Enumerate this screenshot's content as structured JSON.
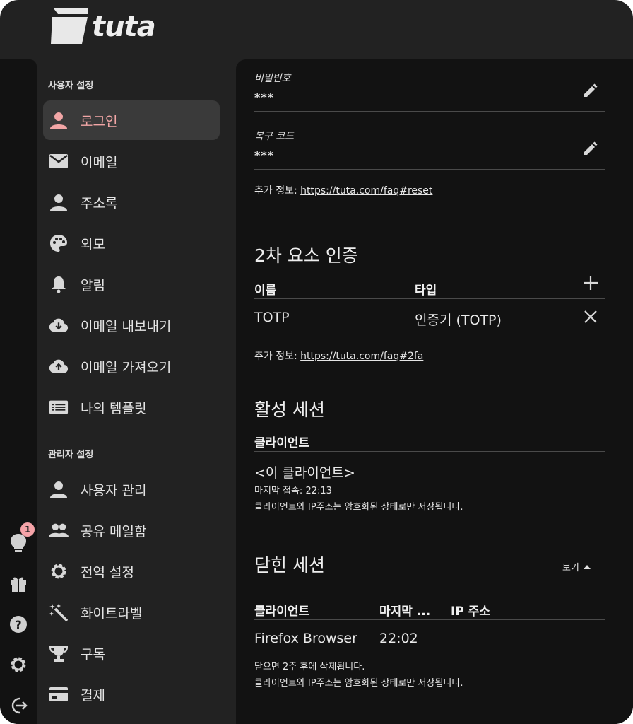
{
  "app": {
    "brand": "tuta"
  },
  "nav": {
    "user_section": "사용자 설정",
    "admin_section": "관리자 설정",
    "items": [
      {
        "label": "로그인",
        "icon": "person-icon"
      },
      {
        "label": "이메일",
        "icon": "mail-icon"
      },
      {
        "label": "주소록",
        "icon": "contacts-icon"
      },
      {
        "label": "외모",
        "icon": "palette-icon"
      },
      {
        "label": "알림",
        "icon": "bell-icon"
      },
      {
        "label": "이메일 내보내기",
        "icon": "cloud-download-icon"
      },
      {
        "label": "이메일 가져오기",
        "icon": "cloud-upload-icon"
      },
      {
        "label": "나의 템플릿",
        "icon": "list-icon"
      }
    ],
    "admin_items": [
      {
        "label": "사용자 관리",
        "icon": "person-icon"
      },
      {
        "label": "공유 메일함",
        "icon": "people-icon"
      },
      {
        "label": "전역 설정",
        "icon": "gear-icon"
      },
      {
        "label": "화이트라벨",
        "icon": "magic-wand-icon"
      },
      {
        "label": "구독",
        "icon": "trophy-icon"
      },
      {
        "label": "결제",
        "icon": "credit-card-icon"
      }
    ]
  },
  "rail": {
    "badge_count": "1"
  },
  "login": {
    "password_label": "비밀번호",
    "password_value": "***",
    "recovery_label": "복구 코드",
    "recovery_value": "***",
    "info_prefix": "추가 정보:",
    "info_link": "https://tuta.com/faq#reset"
  },
  "twofa": {
    "title": "2차 요소 인증",
    "col_name": "이름",
    "col_type": "타입",
    "row_name": "TOTP",
    "row_type": "인증기 (TOTP)",
    "info_prefix": "추가 정보:",
    "info_link": "https://tuta.com/faq#2fa"
  },
  "active_sessions": {
    "title": "활성 세션",
    "col_client": "클라이언트",
    "client": "<이 클라이언트>",
    "last_access": "마지막 접속: 22:13",
    "note": "클라이언트와 IP주소는 암호화된 상태로만 저장됩니다."
  },
  "closed_sessions": {
    "title": "닫힌 세션",
    "toggle_label": "보기",
    "col_client": "클라이언트",
    "col_last": "마지막 ...",
    "col_ip": "IP 주소",
    "row_client": "Firefox Browser",
    "row_last": "22:02",
    "note1": "닫으면 2주 후에 삭제됩니다.",
    "note2": "클라이언트와 IP주소는 암호화된 상태로만 저장됩니다."
  },
  "colors": {
    "accent": "#f2a6a6",
    "background": "#222222",
    "content": "#121212"
  }
}
